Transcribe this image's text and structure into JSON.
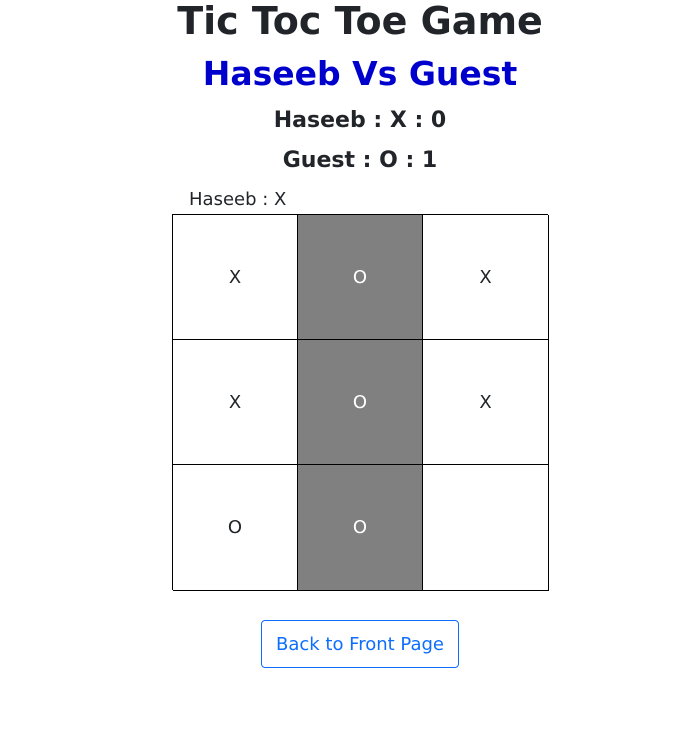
{
  "header": {
    "title": "Tic Toc Toe Game",
    "match": "Haseeb Vs Guest"
  },
  "scores": {
    "player1": "Haseeb : X : 0",
    "player2": "Guest : O : 1"
  },
  "turn": "Haseeb : X",
  "board": {
    "cells": [
      "X",
      "O",
      "X",
      "X",
      "O",
      "X",
      "O",
      "O",
      ""
    ],
    "winning_column": 2
  },
  "actions": {
    "back_label": "Back to Front Page"
  },
  "colors": {
    "match_title": "#0000cd",
    "win_cell": "#808080",
    "button_accent": "#0d6efd"
  }
}
